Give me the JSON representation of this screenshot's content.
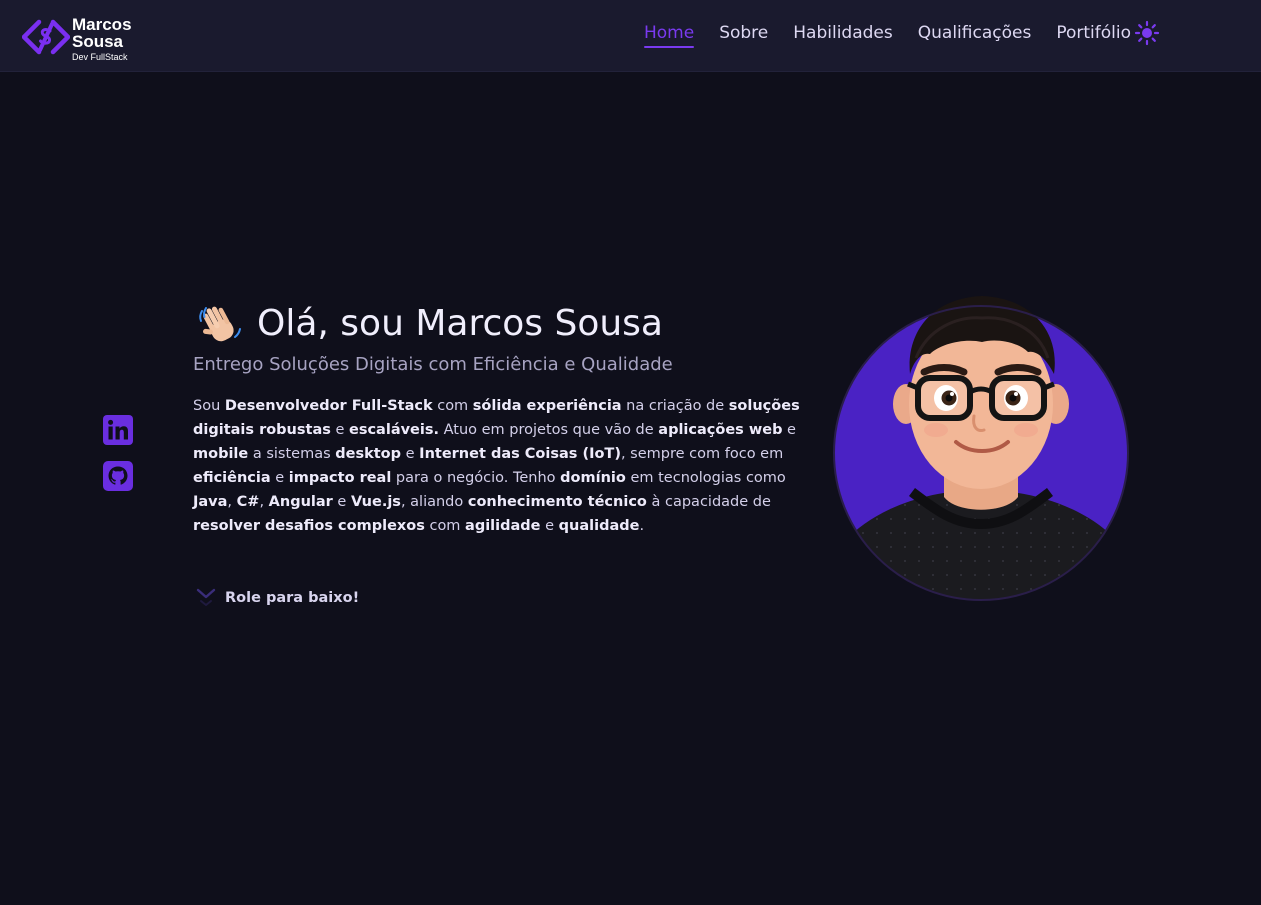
{
  "brand": {
    "name_line1": "Marcos",
    "name_line2": "Sousa",
    "tagline": "Dev FullStack"
  },
  "nav": {
    "items": [
      {
        "label": "Home",
        "active": true
      },
      {
        "label": "Sobre",
        "active": false
      },
      {
        "label": "Habilidades",
        "active": false
      },
      {
        "label": "Qualificações",
        "active": false
      },
      {
        "label": "Portifólio",
        "active": false
      }
    ],
    "theme_icon": "sun-icon"
  },
  "social": [
    {
      "name": "LinkedIn",
      "icon": "linkedin-icon"
    },
    {
      "name": "GitHub",
      "icon": "github-icon"
    }
  ],
  "hero": {
    "title": "Olá, sou Marcos Sousa",
    "subtitle": "Entrego Soluções Digitais com Eficiência e Qualidade",
    "bio": [
      {
        "t": "Sou ",
        "b": false
      },
      {
        "t": "Desenvolvedor Full-Stack",
        "b": true
      },
      {
        "t": " com ",
        "b": false
      },
      {
        "t": "sólida experiência",
        "b": true
      },
      {
        "t": " na criação de ",
        "b": false
      },
      {
        "t": "soluções digitais robustas",
        "b": true
      },
      {
        "t": " e ",
        "b": false
      },
      {
        "t": "escaláveis.",
        "b": true
      },
      {
        "t": " Atuo em projetos que vão de ",
        "b": false
      },
      {
        "t": "aplicações web",
        "b": true
      },
      {
        "t": " e ",
        "b": false
      },
      {
        "t": "mobile",
        "b": true
      },
      {
        "t": " a sistemas ",
        "b": false
      },
      {
        "t": "desktop",
        "b": true
      },
      {
        "t": " e ",
        "b": false
      },
      {
        "t": "Internet das Coisas (IoT)",
        "b": true
      },
      {
        "t": ", sempre com foco em ",
        "b": false
      },
      {
        "t": "eficiência",
        "b": true
      },
      {
        "t": " e ",
        "b": false
      },
      {
        "t": "impacto real",
        "b": true
      },
      {
        "t": " para o negócio. Tenho ",
        "b": false
      },
      {
        "t": "domínio",
        "b": true
      },
      {
        "t": " em tecnologias como ",
        "b": false
      },
      {
        "t": "Java",
        "b": true
      },
      {
        "t": ", ",
        "b": false
      },
      {
        "t": "C#",
        "b": true
      },
      {
        "t": ", ",
        "b": false
      },
      {
        "t": "Angular",
        "b": true
      },
      {
        "t": " e ",
        "b": false
      },
      {
        "t": "Vue.js",
        "b": true
      },
      {
        "t": ", aliando ",
        "b": false
      },
      {
        "t": "conhecimento técnico",
        "b": true
      },
      {
        "t": " à capacidade de ",
        "b": false
      },
      {
        "t": "resolver desafios complexos",
        "b": true
      },
      {
        "t": " com ",
        "b": false
      },
      {
        "t": "agilidade",
        "b": true
      },
      {
        "t": " e ",
        "b": false
      },
      {
        "t": "qualidade",
        "b": true
      },
      {
        "t": ".",
        "b": false
      }
    ],
    "scroll_label": "Role para baixo!"
  },
  "colors": {
    "accent": "#7a3af0",
    "avatar_bg": "#4a22c4",
    "page_bg": "#0f0f1b",
    "nav_bg": "#1a1a2e"
  }
}
